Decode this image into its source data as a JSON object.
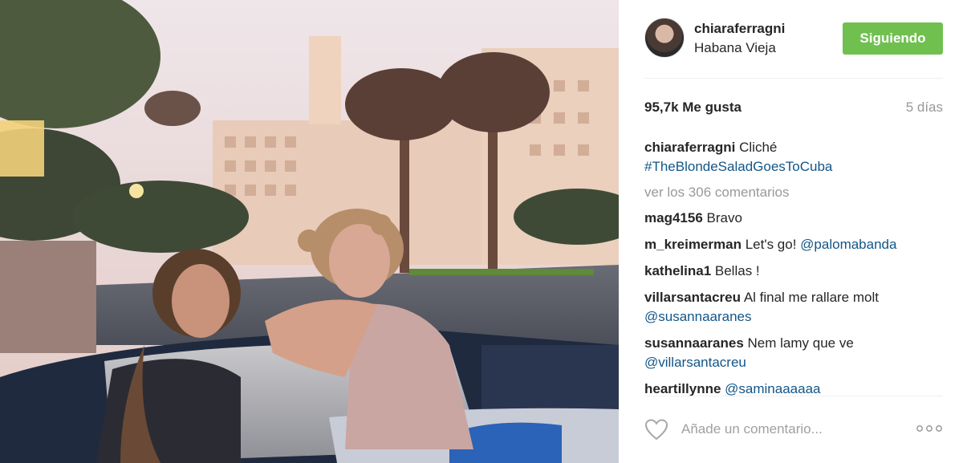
{
  "post": {
    "username": "chiaraferragni",
    "location": "Habana Vieja",
    "follow_label": "Siguiendo",
    "likes": "95,7k Me gusta",
    "time_ago": "5 días"
  },
  "caption": {
    "username": "chiaraferragni",
    "text": "Cliché",
    "hashtag": "#TheBlondeSaladGoesToCuba"
  },
  "view_comments": "ver los 306 comentarios",
  "comments": [
    {
      "user": "mag4156",
      "text": "Bravo",
      "link": ""
    },
    {
      "user": "m_kreimerman",
      "text": "Let's go!",
      "link": "@palomabanda"
    },
    {
      "user": "kathelina1",
      "text": "Bellas !",
      "link": ""
    },
    {
      "user": "villarsantacreu",
      "text": "Al final me rallare molt",
      "link": "@susannaaranes"
    },
    {
      "user": "susannaaranes",
      "text": "Nem lamy que ve",
      "link": "@villarsantacreu"
    },
    {
      "user": "heartillynne",
      "text": "",
      "link": "@saminaaaaaa"
    }
  ],
  "add_comment_placeholder": "Añade un comentario...",
  "icons": {
    "like": "heart-outline-icon",
    "more": "ellipsis-icon"
  },
  "colors": {
    "follow_button": "#70c050",
    "link": "#125688",
    "muted": "#999999"
  }
}
